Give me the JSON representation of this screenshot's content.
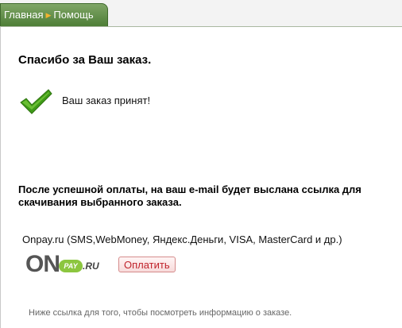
{
  "breadcrumb": {
    "home": "Главная",
    "current": "Помощь"
  },
  "order": {
    "title": "Спасибо за Ваш заказ.",
    "accepted": "Ваш заказ принят!",
    "notice": "После успешной оплаты, на ваш e-mail будет выслана ссылка для скачивания выбранного заказа."
  },
  "payment": {
    "methods": "Onpay.ru (SMS,WebMoney, Яндекс.Деньги, VISA, MasterCard и др.)",
    "logo_on": "ON",
    "logo_pay": "PAY",
    "logo_ru": ".RU",
    "pay_button": "Оплатить"
  },
  "footnote": "Ниже ссылка для того, чтобы посмотреть информацию о заказе.",
  "colors": {
    "tab_green": "#4c7d35",
    "separator": "#f2b32f",
    "check_green": "#3f9a18",
    "button_text": "#c0232b"
  },
  "icons": {
    "check": "check-icon",
    "separator": "arrow-right-icon"
  }
}
